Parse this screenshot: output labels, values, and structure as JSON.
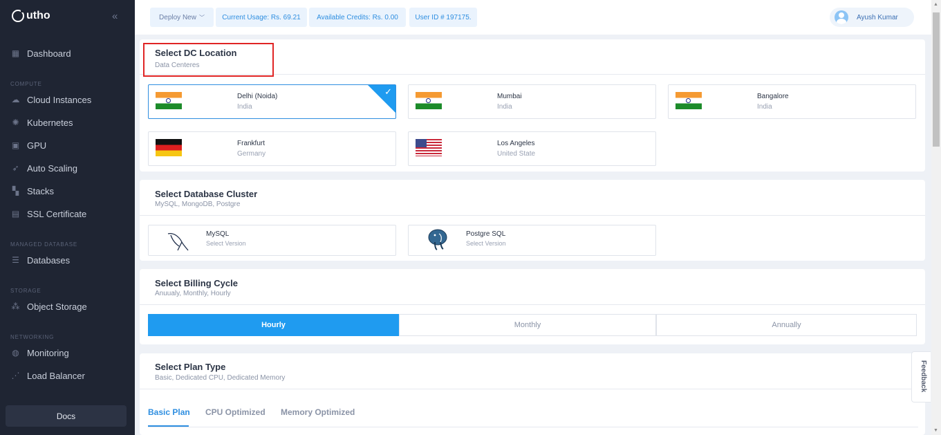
{
  "brand": {
    "name": "utho"
  },
  "sidebar": {
    "collapse_icon": "double-chevron-left-icon",
    "sections": {
      "compute": "COMPUTE",
      "managed_database": "MANAGED DATABASE",
      "storage": "STORAGE",
      "networking": "NETWORKING"
    },
    "items": [
      {
        "label": "Dashboard",
        "icon": "grid-icon"
      },
      {
        "label": "Cloud Instances",
        "icon": "cloud-icon"
      },
      {
        "label": "Kubernetes",
        "icon": "kubernetes-icon"
      },
      {
        "label": "GPU",
        "icon": "gpu-icon"
      },
      {
        "label": "Auto Scaling",
        "icon": "rocket-icon"
      },
      {
        "label": "Stacks",
        "icon": "stacks-icon"
      },
      {
        "label": "SSL Certificate",
        "icon": "certificate-icon"
      },
      {
        "label": "Databases",
        "icon": "database-icon"
      },
      {
        "label": "Object Storage",
        "icon": "object-storage-icon"
      },
      {
        "label": "Monitoring",
        "icon": "globe-icon"
      },
      {
        "label": "Load Balancer",
        "icon": "load-balancer-icon"
      }
    ],
    "docs_label": "Docs"
  },
  "topbar": {
    "deploy_label": "Deploy New",
    "usage": "Current Usage: Rs. 69.21",
    "credits": "Available Credits: Rs. 0.00",
    "user_id": "User ID # 197175.",
    "user_name": "Ayush Kumar"
  },
  "dc_section": {
    "title": "Select DC Location",
    "subtitle": "Data Centeres",
    "locations": [
      {
        "name": "Delhi (Noida)",
        "country": "India",
        "flag": "india",
        "selected": true
      },
      {
        "name": "Mumbai",
        "country": "India",
        "flag": "india",
        "selected": false
      },
      {
        "name": "Bangalore",
        "country": "India",
        "flag": "india",
        "selected": false
      },
      {
        "name": "Frankfurt",
        "country": "Germany",
        "flag": "germany",
        "selected": false
      },
      {
        "name": "Los Angeles",
        "country": "United State",
        "flag": "usa",
        "selected": false
      }
    ]
  },
  "db_section": {
    "title": "Select Database Cluster",
    "subtitle": "MySQL, MongoDB, Postgre",
    "options": [
      {
        "name": "MySQL",
        "sub": "Select Version",
        "icon": "mysql-dolphin-icon"
      },
      {
        "name": "Postgre SQL",
        "sub": "Select Version",
        "icon": "postgresql-elephant-icon"
      }
    ]
  },
  "billing_section": {
    "title": "Select Billing Cycle",
    "subtitle": "Anuualy, Monthly, Hourly",
    "options": [
      "Hourly",
      "Monthly",
      "Annually"
    ],
    "selected": "Hourly"
  },
  "plan_section": {
    "title": "Select Plan Type",
    "subtitle": "Basic, Dedicated CPU, Dedicated Memory",
    "tabs": [
      "Basic Plan",
      "CPU Optimized",
      "Memory Optimized"
    ],
    "active_tab": "Basic Plan"
  },
  "feedback_label": "Feedback",
  "colors": {
    "accent": "#1f9bf0",
    "sidebar_bg": "#1f2533",
    "highlight": "#e02424"
  }
}
